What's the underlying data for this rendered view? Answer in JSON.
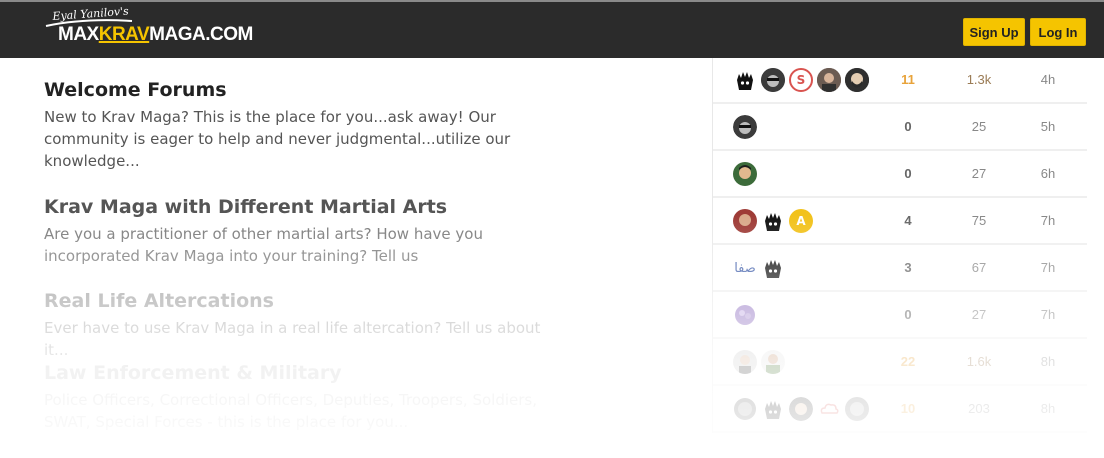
{
  "header": {
    "logo_tagline": "Eyal Yanilov's",
    "logo_max": "MAX",
    "logo_krav": "KRAV",
    "logo_rest": "MAGA.COM",
    "signup_label": "Sign Up",
    "login_label": "Log In"
  },
  "categories": [
    {
      "title": "Welcome Forums",
      "description": "New to Krav Maga? This is the place for you...ask away! Our community is eager to help and never judgmental...utilize our knowledge..."
    },
    {
      "title": "Krav Maga with Different Martial Arts",
      "description": "Are you a practitioner of other martial arts? How have you incorporated Krav Maga into your training? Tell us"
    },
    {
      "title": "Real Life Altercations",
      "description": "Ever have to use Krav Maga in a real life altercation? Tell us about it..."
    },
    {
      "title": "Law Enforcement & Military",
      "description": "Police Officers, Correctional Officers, Deputies, Troopers, Soldiers, SWAT, Special Forces - this is the place for you..."
    }
  ],
  "topics": [
    {
      "replies": "11",
      "views": "1.3k",
      "activity": "4h",
      "replies_color": "#e8a33a",
      "views_color": "#9a7b55",
      "avatars": [
        "ninja-avatar",
        "sunglasses-avatar",
        "letter-s-avatar",
        "man-avatar",
        "bearded-avatar"
      ]
    },
    {
      "replies": "0",
      "views": "25",
      "activity": "5h",
      "replies_color": "#666666",
      "views_color": "#888888",
      "avatars": [
        "sunglasses-avatar"
      ]
    },
    {
      "replies": "0",
      "views": "27",
      "activity": "6h",
      "replies_color": "#666666",
      "views_color": "#888888",
      "avatars": [
        "smiling-man-avatar"
      ]
    },
    {
      "replies": "4",
      "views": "75",
      "activity": "7h",
      "replies_color": "#666666",
      "views_color": "#888888",
      "avatars": [
        "red-man-avatar",
        "ninja-avatar",
        "letter-a-avatar"
      ]
    },
    {
      "replies": "3",
      "views": "67",
      "activity": "7h",
      "replies_color": "#666666",
      "views_color": "#888888",
      "avatars": [
        "arabic-script-avatar",
        "ninja-avatar"
      ]
    },
    {
      "replies": "0",
      "views": "27",
      "activity": "7h",
      "replies_color": "#666666",
      "views_color": "#888888",
      "avatars": [
        "purple-flower-avatar"
      ]
    },
    {
      "replies": "22",
      "views": "1.6k",
      "activity": "8h",
      "replies_color": "#e8a33a",
      "views_color": "#9a7b55",
      "avatars": [
        "man-avatar",
        "green-shirt-avatar"
      ]
    },
    {
      "replies": "10",
      "views": "203",
      "activity": "8h",
      "replies_color": "#e8a33a",
      "views_color": "#888888",
      "avatars": [
        "badge-avatar",
        "ninja-avatar",
        "woman-avatar",
        "cloud-avatar",
        "monkey-avatar"
      ]
    }
  ],
  "avatar_text": {
    "letter_s": "S",
    "letter_a": "A",
    "arabic": "صفا"
  }
}
